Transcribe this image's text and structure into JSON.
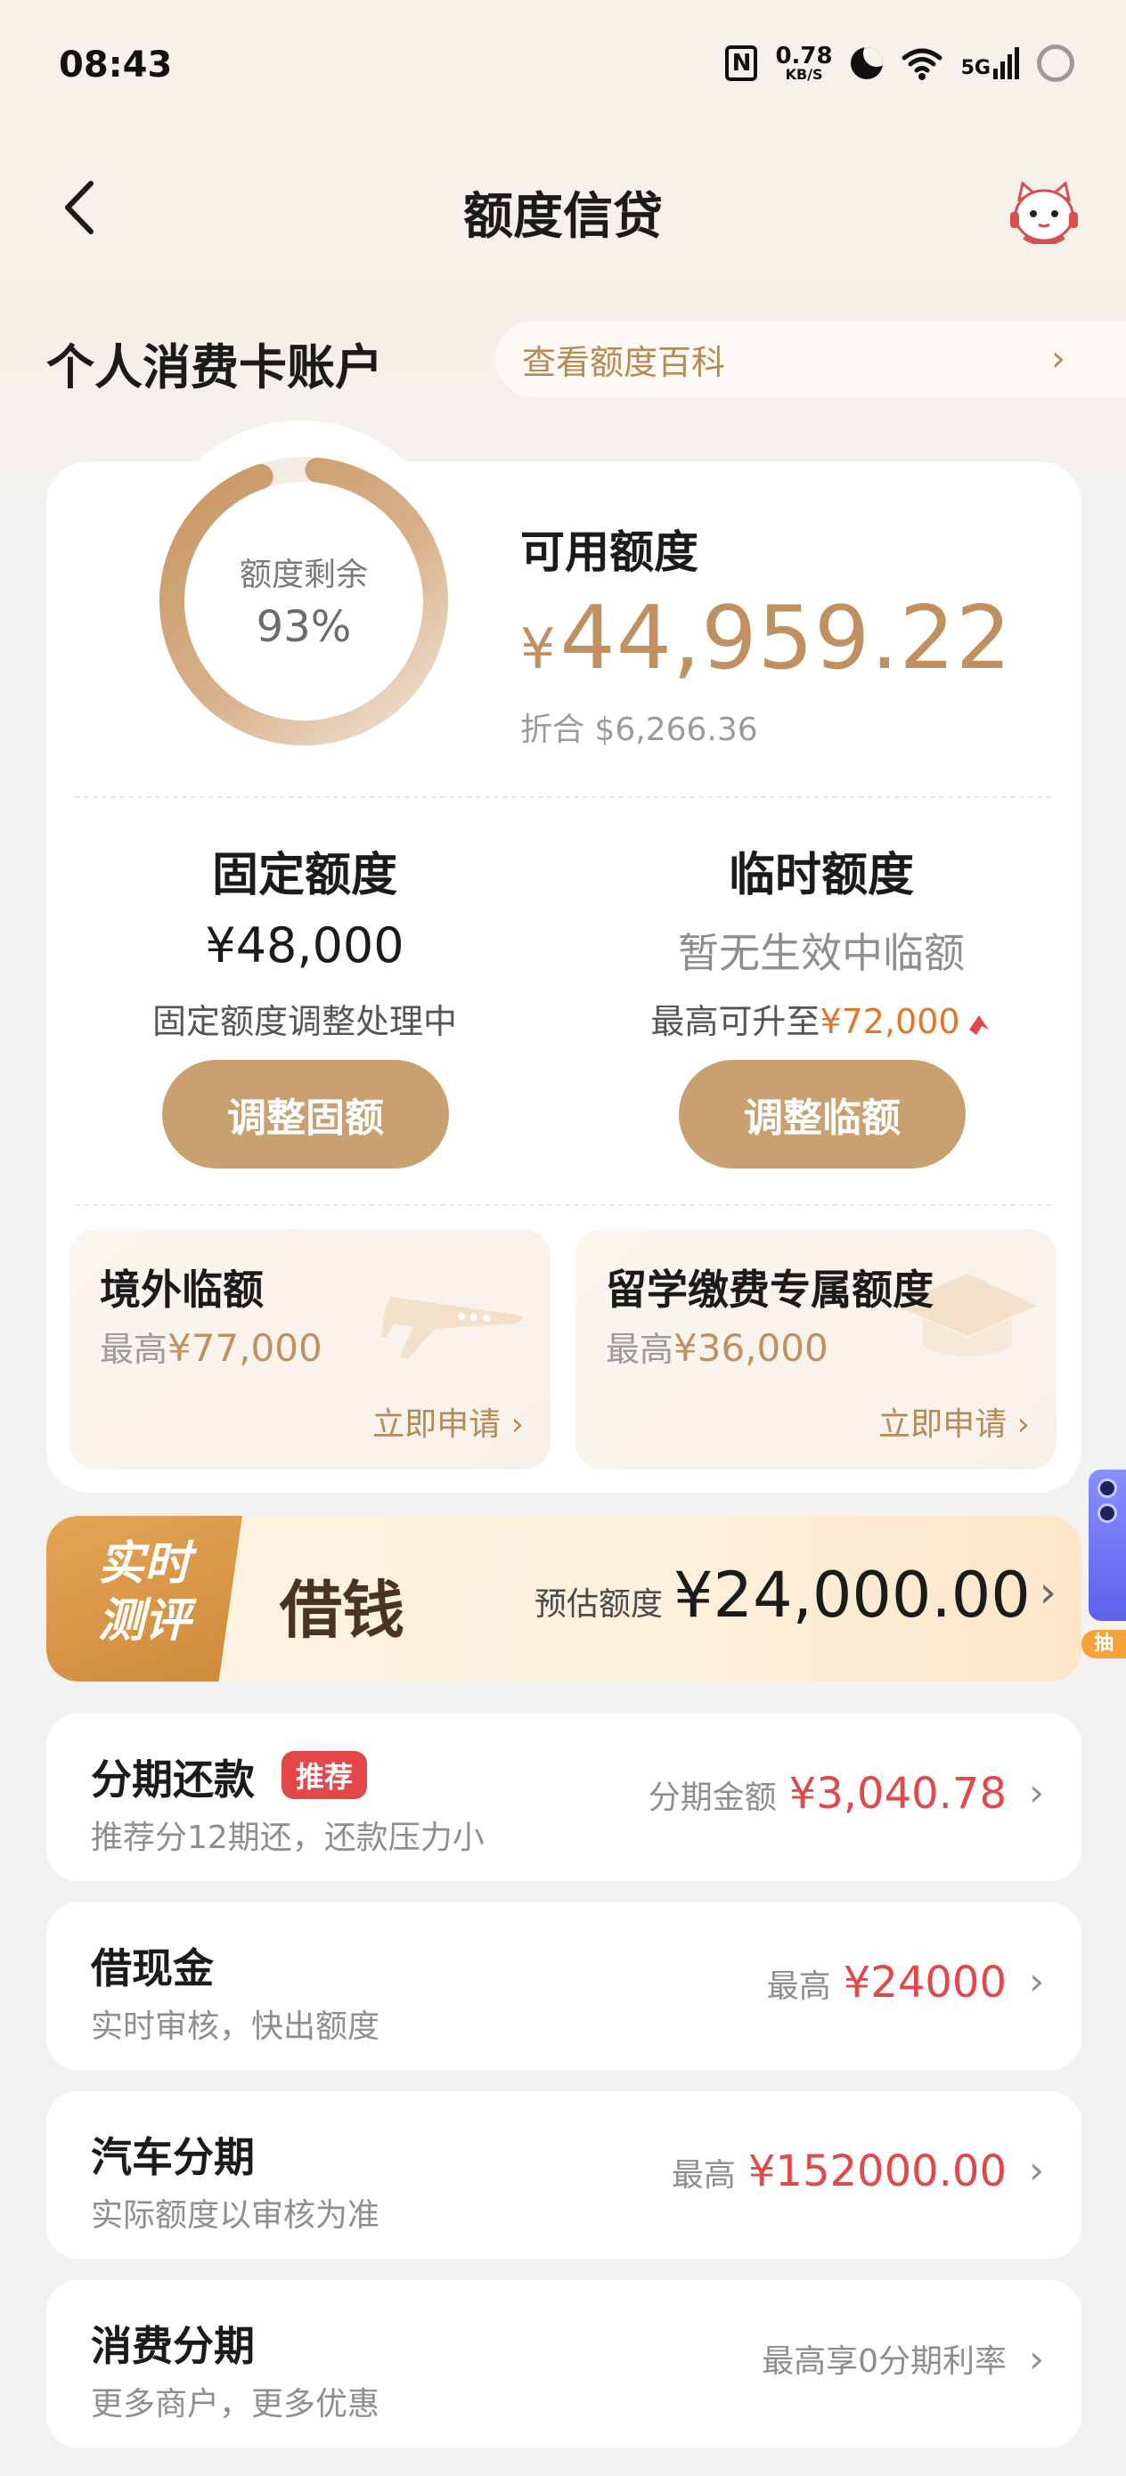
{
  "status_bar": {
    "time": "08:43",
    "nfc_icon": "N",
    "speed_value": "0.78",
    "speed_unit": "KB/S",
    "network": "5G"
  },
  "nav": {
    "title": "额度信贷",
    "back_icon": "chevron-left-icon",
    "assistant_icon": "cat-mascot-icon"
  },
  "account": {
    "title": "个人消费卡账户",
    "encyclopedia_label": "查看额度百科"
  },
  "credit": {
    "ring_label": "额度剩余",
    "ring_percent_text": "93%",
    "ring_fraction": 0.93,
    "available_label": "可用额度",
    "available_currency": "¥",
    "available_amount": "44,959.22",
    "converted_text": "折合 $6,266.36",
    "fixed": {
      "title": "固定额度",
      "amount": "¥48,000",
      "note": "固定额度调整处理中",
      "button": "调整固额"
    },
    "temporary": {
      "title": "临时额度",
      "status": "暂无生效中临额",
      "note_prefix": "最高可升至",
      "note_amount": "¥72,000",
      "button": "调整临额"
    }
  },
  "sub_cards": [
    {
      "title": "境外临额",
      "prefix": "最高",
      "amount": "¥77,000",
      "action": "立即申请 ›",
      "icon": "airplane-icon"
    },
    {
      "title": "留学缴费专属额度",
      "prefix": "最高",
      "amount": "¥36,000",
      "action": "立即申请 ›",
      "icon": "graduation-cap-icon"
    }
  ],
  "loan_banner": {
    "tag_line1": "实时",
    "tag_line2": "测评",
    "name": "借钱",
    "estimate_label": "预估额度",
    "estimate_amount": "¥24,000.00"
  },
  "rows": [
    {
      "title": "分期还款",
      "badge": "推荐",
      "subtitle": "推荐分12期还，还款压力小",
      "right_label": "分期金额",
      "right_value": "¥3,040.78"
    },
    {
      "title": "借现金",
      "subtitle": "实时审核，快出额度",
      "right_label": "最高",
      "right_value": "¥24000"
    },
    {
      "title": "汽车分期",
      "subtitle": "实际额度以审核为准",
      "right_label": "最高",
      "right_value": "¥152000.00"
    },
    {
      "title": "消费分期",
      "subtitle": "更多商户，更多优惠",
      "right_label": "最高享0分期利率"
    }
  ],
  "float_ad": {
    "label": "抽"
  },
  "colors": {
    "gold": "#c09060",
    "button_gold": "#c9a070",
    "red": "#e2474a",
    "orange": "#e0762c"
  }
}
